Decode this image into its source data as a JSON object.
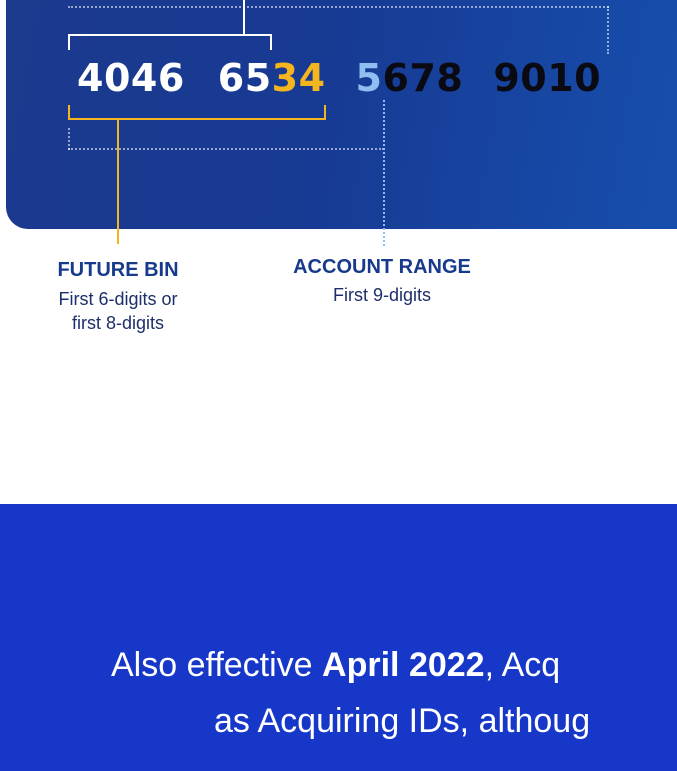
{
  "card": {
    "group1": "4046",
    "group2_white": "65",
    "group2_yellow": "34",
    "group3_blue": "5",
    "group3_black": "678",
    "group4": "9010"
  },
  "labels": {
    "future_bin_title": "FUTURE BIN",
    "future_bin_line1": "First 6-digits or",
    "future_bin_line2": "first 8-digits",
    "account_range_title": "ACCOUNT RANGE",
    "account_range_sub": "First 9-digits"
  },
  "banner": {
    "line1_pre": "Also effective ",
    "line1_bold": "April 2022",
    "line1_post": ", Acq",
    "line2": "as Acquiring IDs, althoug"
  },
  "colors": {
    "card_blue": "#173a93",
    "accent_yellow": "#f5b51e",
    "accent_lightblue": "#8fbef0",
    "label_navy": "#173a8c",
    "banner_blue": "#1637c8"
  }
}
